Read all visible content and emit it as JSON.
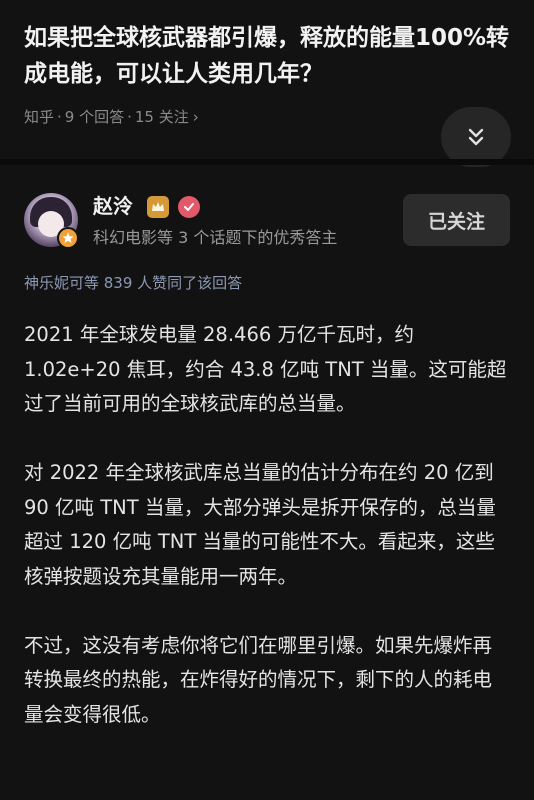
{
  "question": {
    "title": "如果把全球核武器都引爆，释放的能量100%转成电能，可以让人类用几年？",
    "source": "知乎",
    "answers": "9 个回答",
    "followers": "15 关注"
  },
  "author": {
    "name": "赵泠",
    "description": "科幻电影等 3 个话题下的优秀答主",
    "follow_label": "已关注"
  },
  "likes_text": "神乐妮可等 839 人赞同了该回答",
  "answer": {
    "paragraphs": [
      "2021 年全球发电量 28.466 万亿千瓦时，约 1.02e+20 焦耳，约合 43.8 亿吨 TNT 当量。这可能超过了当前可用的全球核武库的总当量。",
      "对 2022 年全球核武库总当量的估计分布在约 20 亿到 90 亿吨 TNT 当量，大部分弹头是拆开保存的，总当量超过 120 亿吨 TNT 当量的可能性不大。看起来，这些核弹按题设充其量能用一两年。",
      "不过，这没有考虑你将它们在哪里引爆。如果先爆炸再转换最终的热能，在炸得好的情况下，剩下的人的耗电量会变得很低。"
    ]
  },
  "icons": {
    "collapse": "double-chevron-down-icon",
    "crown": "crown-badge-icon",
    "verified": "verified-check-icon",
    "star": "star-badge-icon"
  },
  "colors": {
    "background": "#121212",
    "likes_text": "#8d98b3",
    "crown_badge": "#d49a3a",
    "verified_badge": "#e25a6a",
    "avatar_badge": "#f0a23a"
  }
}
